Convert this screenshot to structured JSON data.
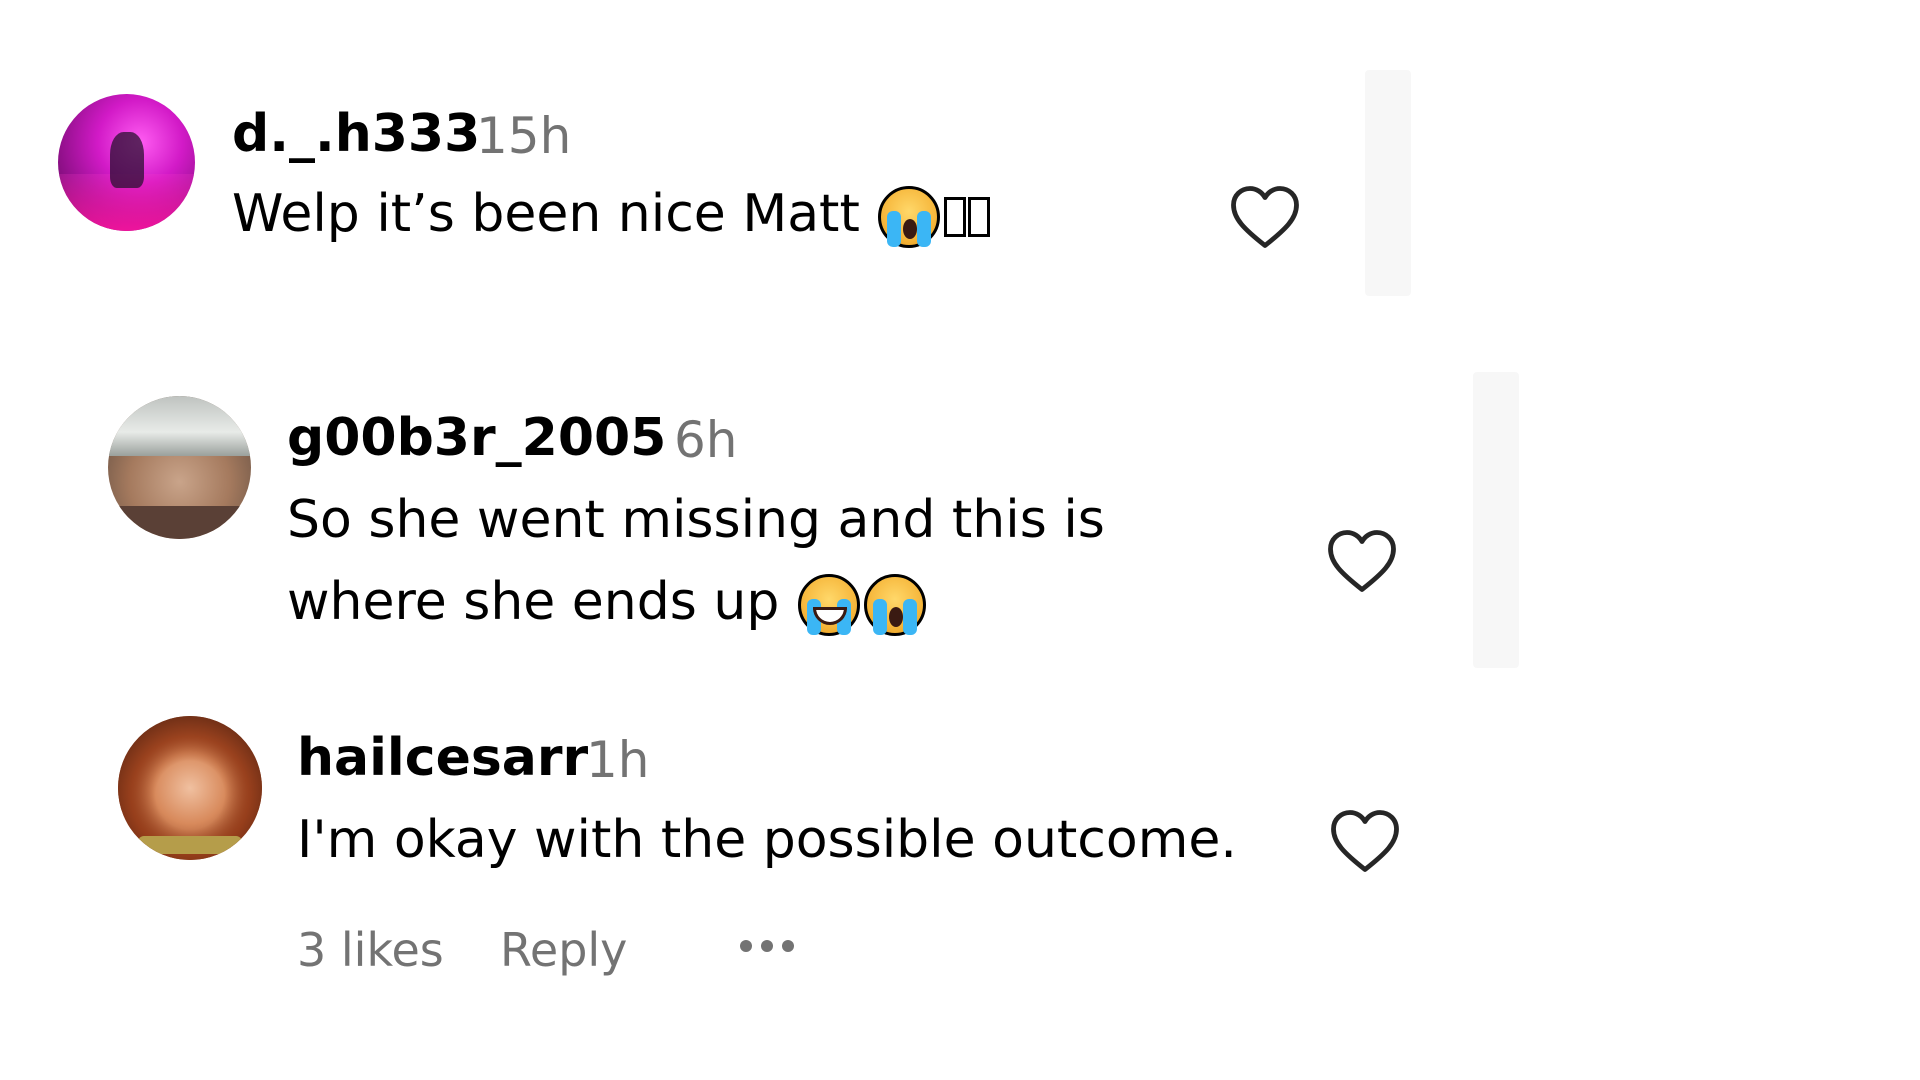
{
  "comments": [
    {
      "username": "d._.h333",
      "time": "15h",
      "text": "Welp it’s been nice Matt",
      "emojis": [
        "loudly-crying-face-emoji"
      ],
      "missing_glyphs": 2,
      "like_icon": "heart-outline-icon"
    },
    {
      "username": "g00b3r_2005",
      "time": "6h",
      "text_line1": "So she went missing and this is",
      "text_line2": "where she ends up",
      "emojis": [
        "face-with-tears-of-joy-emoji",
        "loudly-crying-face-emoji"
      ],
      "like_icon": "heart-outline-icon"
    },
    {
      "username": "hailcesarr",
      "time": "1h",
      "text": "I'm okay with the possible outcome.",
      "like_icon": "heart-outline-icon",
      "likes": "3 likes",
      "reply_label": "Reply",
      "more_icon": "more-options-icon"
    }
  ]
}
